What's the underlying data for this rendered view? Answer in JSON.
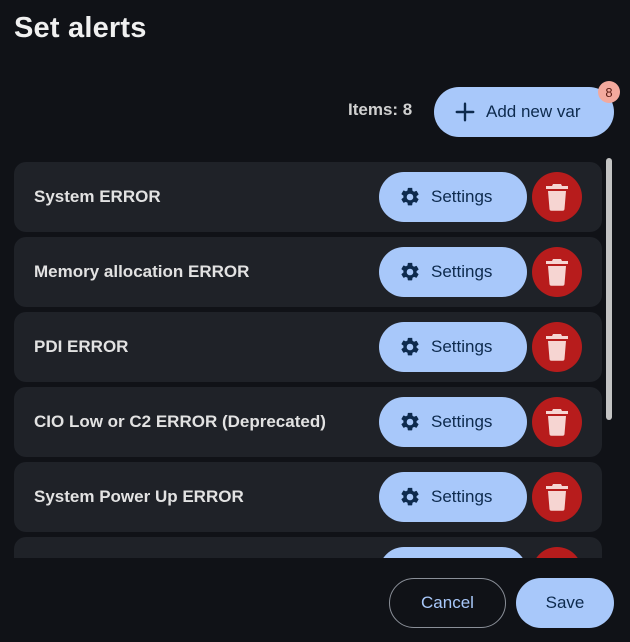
{
  "dialog": {
    "title": "Set alerts",
    "items_count_label": "Items: 8",
    "add_button_label": "Add new var",
    "badge_count": "8"
  },
  "alerts": [
    {
      "name": "System ERROR",
      "settings_label": "Settings"
    },
    {
      "name": "Memory allocation ERROR",
      "settings_label": "Settings"
    },
    {
      "name": "PDI ERROR",
      "settings_label": "Settings"
    },
    {
      "name": "CIO Low or C2 ERROR (Deprecated)",
      "settings_label": "Settings"
    },
    {
      "name": "System Power Up ERROR",
      "settings_label": "Settings"
    },
    {
      "name": "",
      "settings_label": ""
    }
  ],
  "footer": {
    "cancel_label": "Cancel",
    "save_label": "Save"
  },
  "colors": {
    "background": "#101217",
    "row": "#1f2228",
    "primary": "#a8c8fa",
    "danger": "#b71c1c",
    "badge": "#f3a99d"
  },
  "icons": {
    "add": "plus-icon",
    "settings": "gear-icon",
    "delete": "trash-icon"
  }
}
